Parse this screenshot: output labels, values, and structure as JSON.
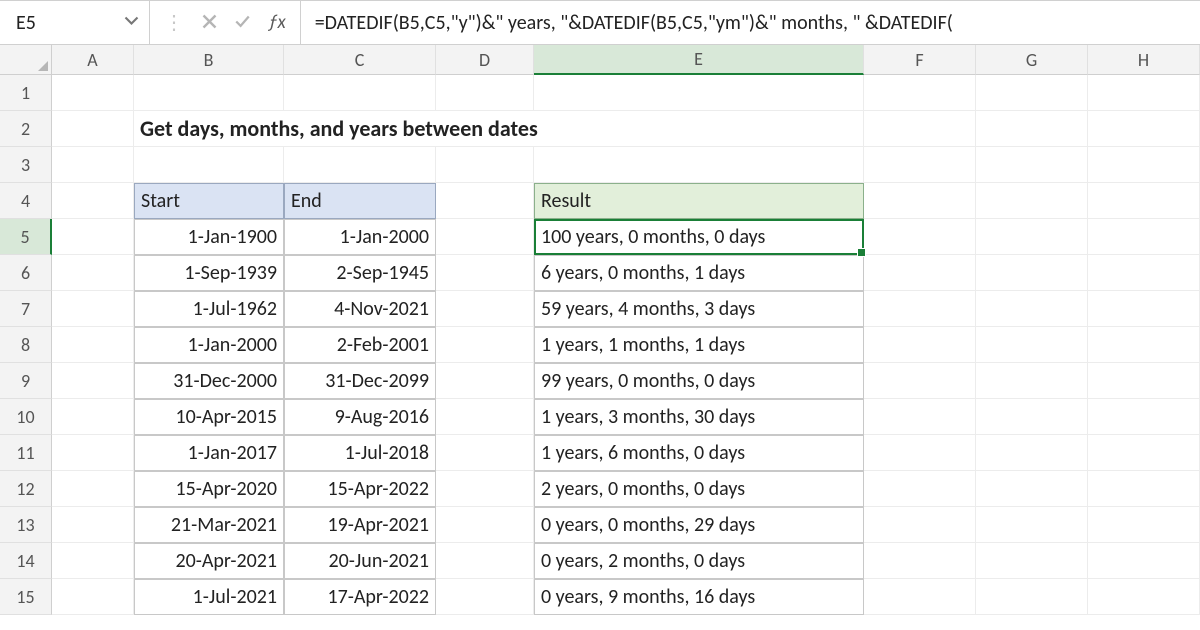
{
  "namebox": {
    "value": "E5"
  },
  "formula_bar": {
    "value": "=DATEDIF(B5,C5,\"y\")&\" years, \"&DATEDIF(B5,C5,\"ym\")&\" months, \" &DATEDIF("
  },
  "columns": [
    "A",
    "B",
    "C",
    "D",
    "E",
    "F",
    "G",
    "H"
  ],
  "active_col": "E",
  "active_row": 5,
  "title": "Get days, months, and years between dates",
  "headers": {
    "start": "Start",
    "end": "End",
    "result": "Result"
  },
  "rows": [
    {
      "start": "1-Jan-1900",
      "end": "1-Jan-2000",
      "result": "100 years, 0 months, 0 days"
    },
    {
      "start": "1-Sep-1939",
      "end": "2-Sep-1945",
      "result": "6 years, 0 months, 1 days"
    },
    {
      "start": "1-Jul-1962",
      "end": "4-Nov-2021",
      "result": "59 years, 4 months, 3 days"
    },
    {
      "start": "1-Jan-2000",
      "end": "2-Feb-2001",
      "result": "1 years, 1 months, 1 days"
    },
    {
      "start": "31-Dec-2000",
      "end": "31-Dec-2099",
      "result": "99 years, 0 months, 0 days"
    },
    {
      "start": "10-Apr-2015",
      "end": "9-Aug-2016",
      "result": "1 years, 3 months, 30 days"
    },
    {
      "start": "1-Jan-2017",
      "end": "1-Jul-2018",
      "result": "1 years, 6 months, 0 days"
    },
    {
      "start": "15-Apr-2020",
      "end": "15-Apr-2022",
      "result": "2 years, 0 months, 0 days"
    },
    {
      "start": "21-Mar-2021",
      "end": "19-Apr-2021",
      "result": "0 years, 0 months, 29 days"
    },
    {
      "start": "20-Apr-2021",
      "end": "20-Jun-2021",
      "result": "0 years, 2 months, 0 days"
    },
    {
      "start": "1-Jul-2021",
      "end": "17-Apr-2022",
      "result": "0 years, 9 months, 16 days"
    }
  ]
}
